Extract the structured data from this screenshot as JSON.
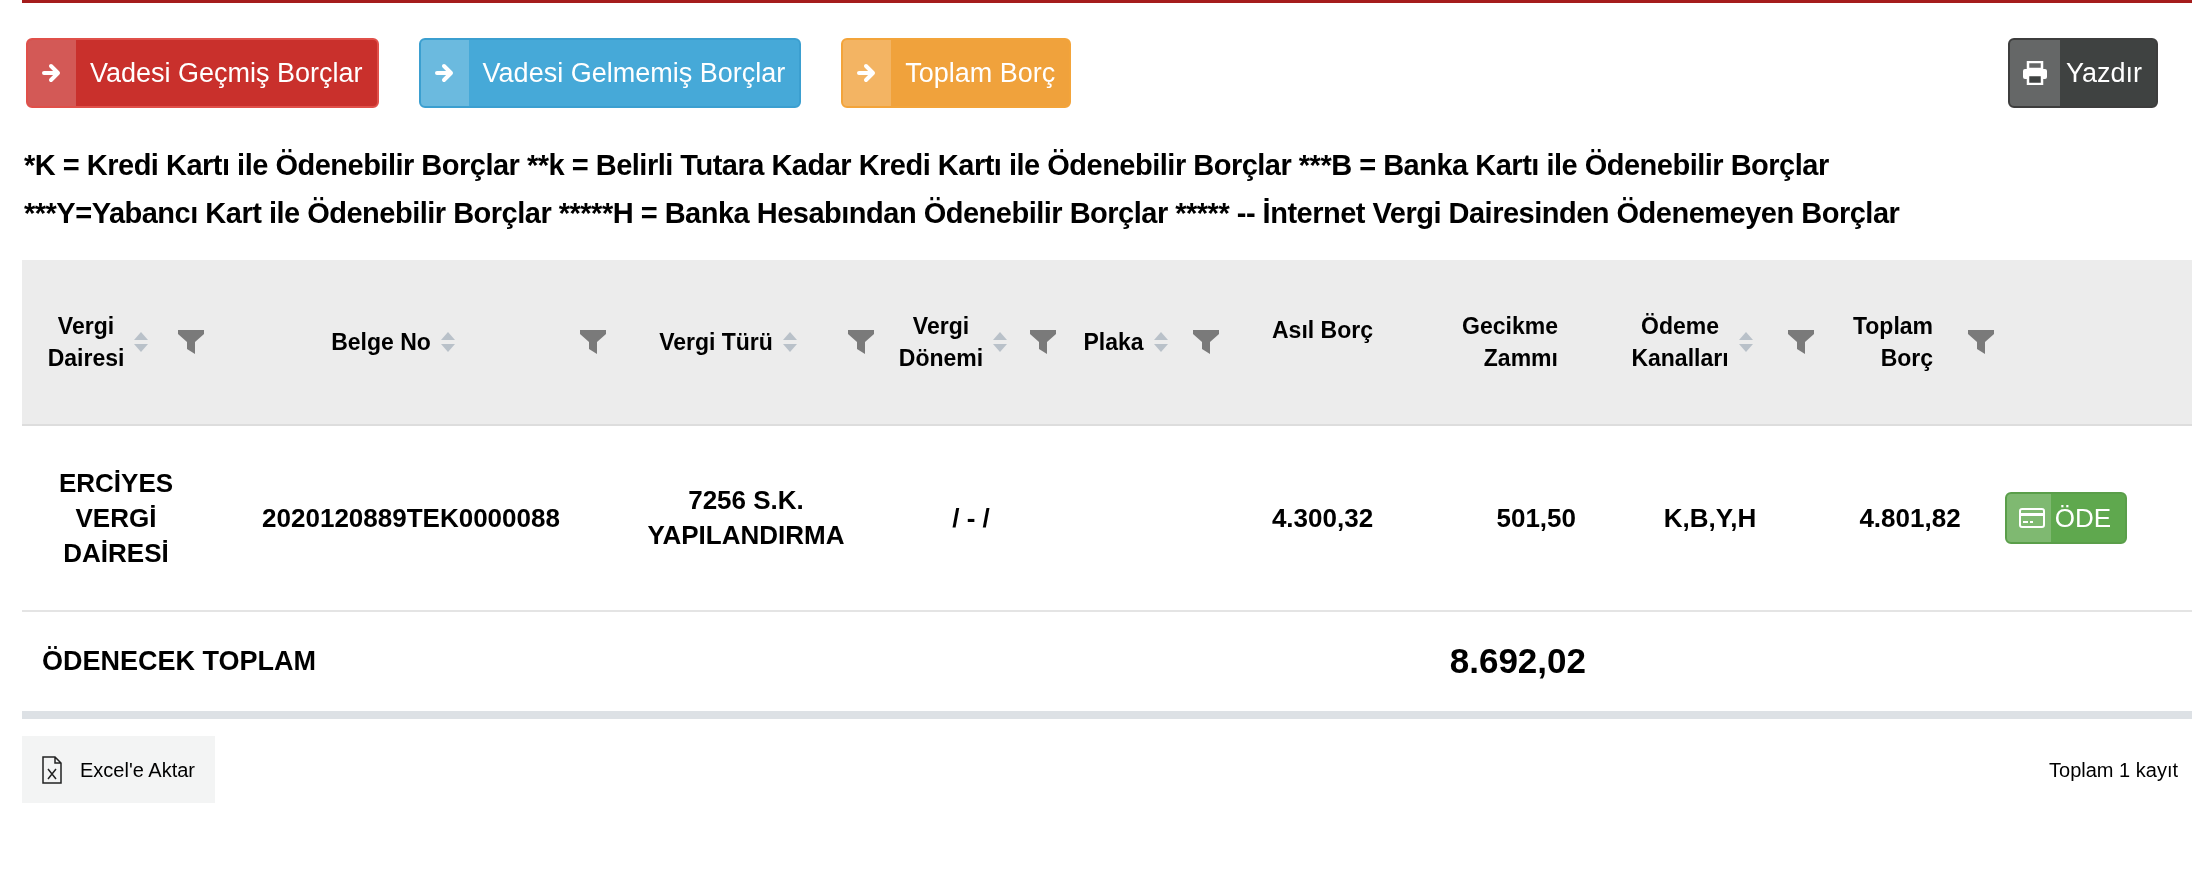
{
  "top_buttons": [
    {
      "label": "Vadesi Geçmiş Borçlar",
      "kind": "danger"
    },
    {
      "label": "Vadesi Gelmemiş Borçlar",
      "kind": "info"
    },
    {
      "label": "Toplam Borç",
      "kind": "warning"
    }
  ],
  "print_button": {
    "label": "Yazdır"
  },
  "legend": [
    "*K = Kredi Kartı ile Ödenebilir Borçlar **k = Belirli Tutara Kadar Kredi Kartı ile Ödenebilir Borçlar ***B = Banka Kartı ile Ödenebilir Borçlar",
    "***Y=Yabancı Kart ile Ödenebilir Borçlar *****H = Banka Hesabından Ödenebilir Borçlar ***** -- İnternet Vergi Dairesinden Ödenemeyen Borçlar"
  ],
  "table": {
    "columns": [
      {
        "label": "Vergi Dairesi",
        "sortable": true,
        "filterable": true
      },
      {
        "label": "Belge No",
        "sortable": true,
        "filterable": true
      },
      {
        "label": "Vergi Türü",
        "sortable": true,
        "filterable": true
      },
      {
        "label": "Vergi Dönemi",
        "sortable": true,
        "filterable": true
      },
      {
        "label": "Plaka",
        "sortable": true,
        "filterable": true
      },
      {
        "label": "Asıl Borç",
        "sortable": false,
        "filterable": false
      },
      {
        "label": "Gecikme Zammı",
        "sortable": false,
        "filterable": false
      },
      {
        "label": "Ödeme Kanalları",
        "sortable": true,
        "filterable": true
      },
      {
        "label": "Toplam Borç",
        "sortable": false,
        "filterable": true
      }
    ],
    "rows": [
      {
        "cells": [
          "ERCİYES VERGİ DAİRESİ",
          "2020120889TEK0000088",
          "7256 S.K. YAPILANDIRMA",
          "/ - /",
          "",
          "4.300,32",
          "501,50",
          "K,B,Y,H",
          "4.801,82"
        ],
        "action": "ÖDE"
      }
    ],
    "total": {
      "label": "ÖDENECEK TOPLAM",
      "value": "8.692,02"
    }
  },
  "footer": {
    "export_button": "Excel'e Aktar",
    "record_count": "Toplam 1 kayıt"
  }
}
